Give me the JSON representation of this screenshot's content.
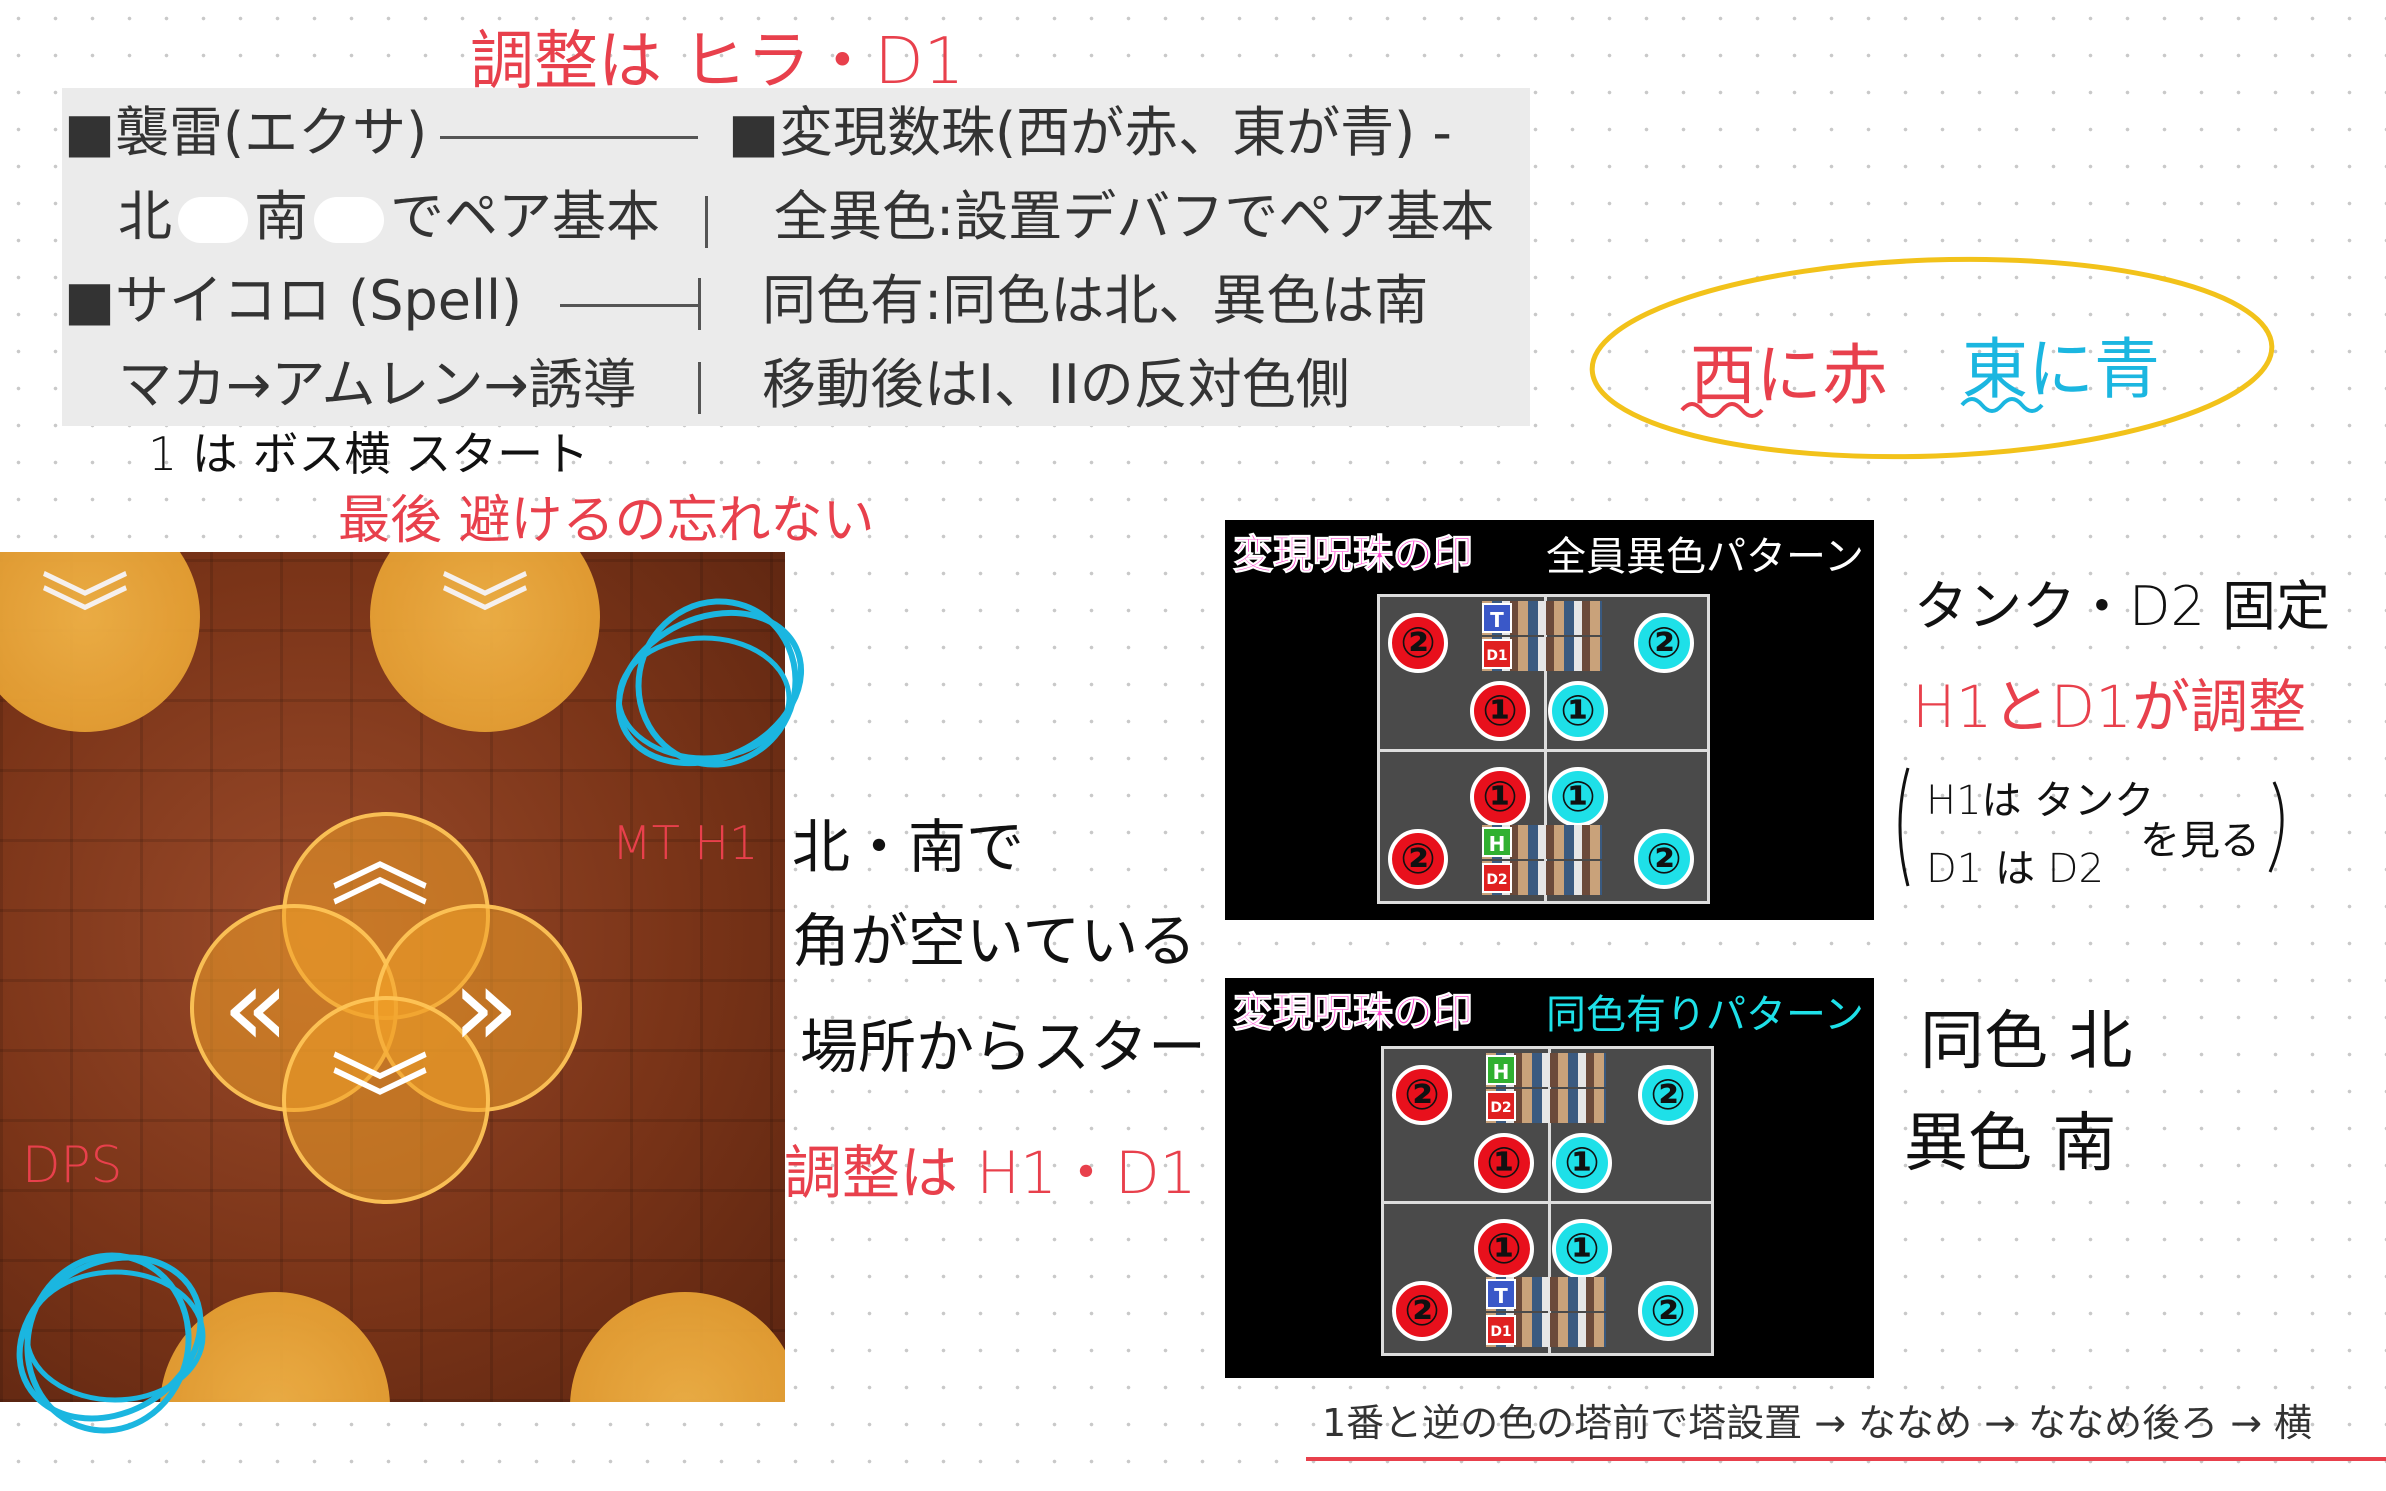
{
  "notes": {
    "top_adjust": "調整は ヒラ・D1",
    "start_note": "1 は ボス横 スタート",
    "last_note": "最後 避けるの忘れない",
    "corner_note": [
      "北・南で",
      "角が空いている",
      "場所からスタート"
    ],
    "adjust_h1d1": "調整は H1・D1",
    "mt_h1": "MT H1",
    "dps": "DPS",
    "west_red": "西に赤",
    "east_blue": "東に青",
    "tank_fixed": "タンク・D2 固定",
    "h1_d1_adjust": "H1とD1が調整",
    "h1_look": "H1は タンク",
    "d1_look": "D1 は D2",
    "look": "を見る",
    "same_north": "同色 北",
    "diff_south": "異色 南",
    "bottom_line": "1番と逆の色の塔前で塔設置 → ななめ → ななめ後ろ → 横"
  },
  "panel": {
    "line1_left": "■襲雷(エクサ)",
    "line1_right": "■変現数珠(西が赤、東が青) -",
    "line2_left_a": "北",
    "line2_left_b": "南",
    "line2_left_c": "でペア基本",
    "line2_right": "全異色:設置デバフでペア基本",
    "line3_left": "■サイコロ (Spell)",
    "line3_right": "同色有:同色は北、異色は南",
    "line4_left": "マカ→アムレン→誘導",
    "line4_right": "移動後はI、IIの反対色側"
  },
  "pattern1": {
    "title": "変現呪珠の印",
    "subtitle": "全員異色パターン",
    "tags": [
      "T",
      "D1",
      "H",
      "D2"
    ],
    "orb_labels": [
      "②",
      "②",
      "①",
      "①",
      "①",
      "①",
      "②",
      "②"
    ]
  },
  "pattern2": {
    "title": "変現呪珠の印",
    "subtitle": "同色有りパターン",
    "tags": [
      "H",
      "D2",
      "T",
      "D1"
    ],
    "orb_labels": [
      "②",
      "②",
      "①",
      "①",
      "①",
      "①",
      "②",
      "②"
    ]
  },
  "colors": {
    "red": "#e8404c",
    "cyan": "#1bb6e0",
    "yellow": "#f2c21a",
    "orb_red": "#e8101c",
    "orb_blue": "#1ee0e8"
  }
}
